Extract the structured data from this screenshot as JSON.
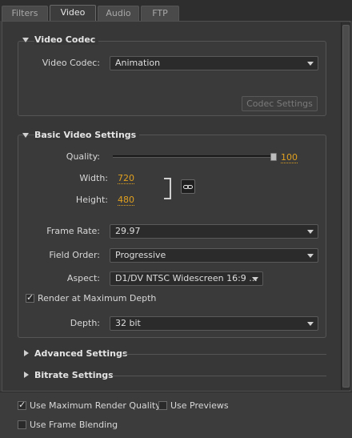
{
  "tabs": [
    {
      "label": "Filters",
      "active": false
    },
    {
      "label": "Video",
      "active": true
    },
    {
      "label": "Audio",
      "active": false
    },
    {
      "label": "FTP",
      "active": false
    }
  ],
  "video_codec_section": {
    "title": "Video Codec",
    "codec_label": "Video Codec:",
    "codec_value": "Animation",
    "codec_settings_button": "Codec Settings"
  },
  "basic_video": {
    "title": "Basic Video Settings",
    "quality_label": "Quality:",
    "quality_value": "100",
    "width_label": "Width:",
    "width_value": "720",
    "height_label": "Height:",
    "height_value": "480",
    "frame_rate_label": "Frame Rate:",
    "frame_rate_value": "29.97",
    "field_order_label": "Field Order:",
    "field_order_value": "Progressive",
    "aspect_label": "Aspect:",
    "aspect_value": "D1/DV NTSC Widescreen 16:9 ...",
    "render_max_depth_label": "Render at Maximum Depth",
    "render_max_depth_checked": true,
    "depth_label": "Depth:",
    "depth_value": "32 bit"
  },
  "collapsed_sections": {
    "advanced": "Advanced Settings",
    "bitrate": "Bitrate Settings"
  },
  "bottom_options": {
    "max_render_quality_label": "Use Maximum Render Quality",
    "max_render_quality_checked": true,
    "use_previews_label": "Use Previews",
    "use_previews_checked": false,
    "frame_blending_label": "Use Frame Blending",
    "frame_blending_checked": false
  },
  "colors": {
    "value_accent": "#e0a020",
    "background": "#3c3c3c"
  }
}
